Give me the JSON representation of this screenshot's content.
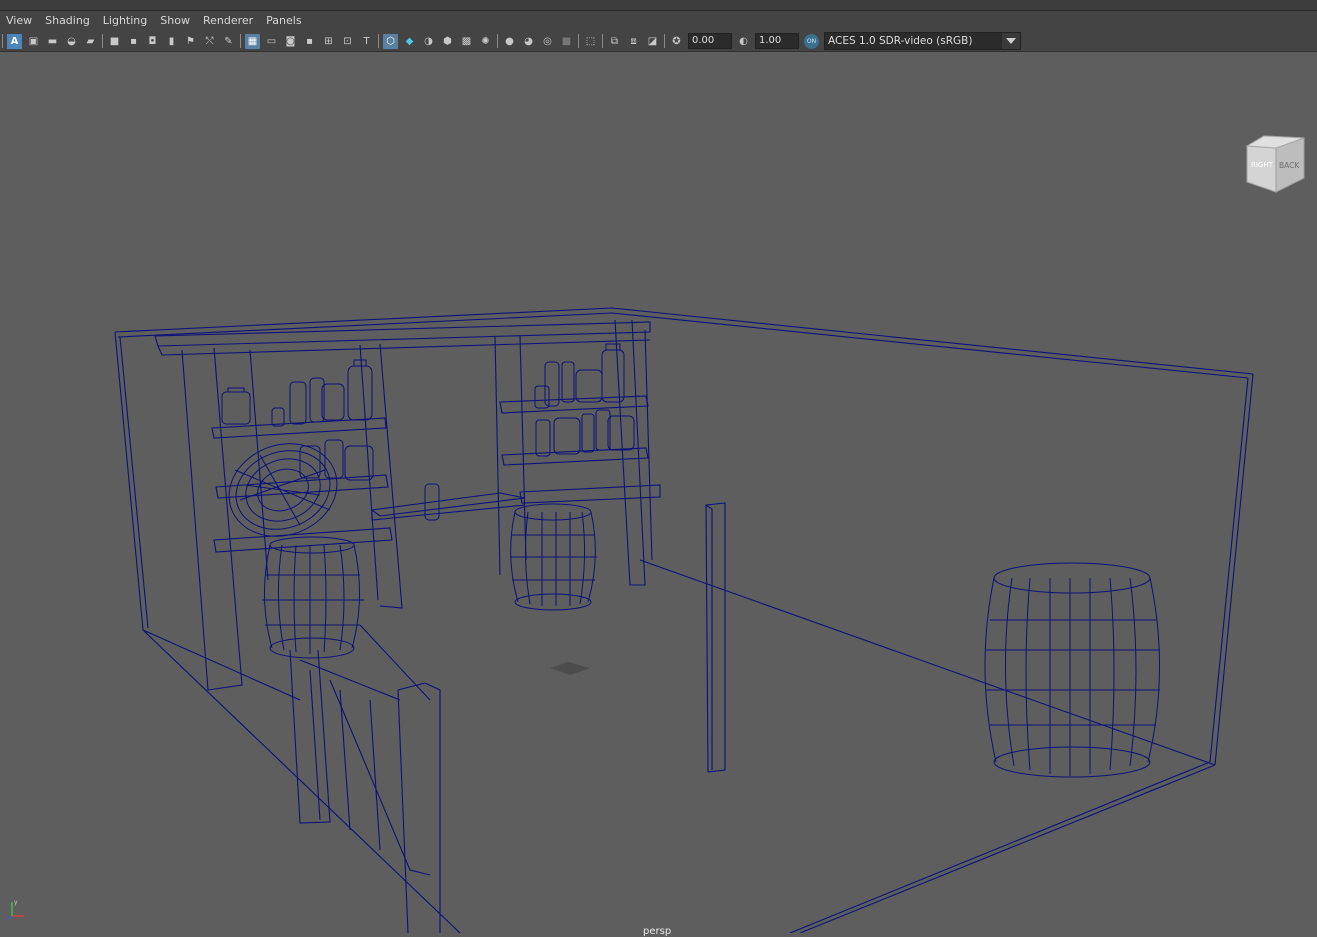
{
  "menu": [
    "View",
    "Shading",
    "Lighting",
    "Show",
    "Renderer",
    "Panels"
  ],
  "toolbar": {
    "exposure_value": "0.00",
    "gamma_value": "1.00",
    "colorspace_badge": "ON",
    "colorspace": "ACES 1.0 SDR-video (sRGB)"
  },
  "viewcube": {
    "left_face": "RIGHT",
    "front_face": "BACK"
  },
  "viewport": {
    "camera": "persp",
    "axis_y": "y",
    "axis_x": "x"
  },
  "colors": {
    "wireframe": "#0d1278",
    "background": "#5e5e5e",
    "panel": "#444444"
  }
}
